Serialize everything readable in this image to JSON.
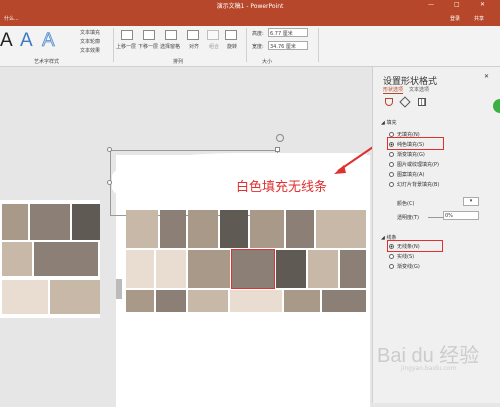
{
  "window": {
    "title": "演示文稿1 - PowerPoint",
    "login": "登录",
    "share": "共享",
    "min": "—",
    "max": "□",
    "close": "✕"
  },
  "ribbon_tabs": [
    "什么..."
  ],
  "ribbon": {
    "art_text_styles_label": "艺术字样式",
    "text_fill": "文本填充",
    "text_outline": "文本轮廓",
    "text_effects": "文本效果",
    "bring_forward": "上移一层",
    "send_backward": "下移一层",
    "selection_pane": "选择窗格",
    "align": "对齐",
    "group": "组合",
    "rotate": "旋转",
    "arrange_label": "排列",
    "height_label": "高度:",
    "height_value": "6.77 厘米",
    "width_label": "宽度:",
    "width_value": "34.76 厘米",
    "size_label": "大小",
    "art_A": "A"
  },
  "slide": {
    "caption": "白色填充无线条"
  },
  "pane": {
    "title": "设置形状格式",
    "tab_shape": "形状选项",
    "tab_text": "文本选项",
    "fill_header": "填充",
    "fill_options": [
      "无填充(N)",
      "纯色填充(S)",
      "渐变填充(G)",
      "图片或纹理填充(P)",
      "图案填充(A)",
      "幻灯片背景填充(B)"
    ],
    "fill_selected": 1,
    "color_label": "颜色(C)",
    "transparency_label": "透明度(T)",
    "transparency_value": "0%",
    "line_header": "线条",
    "line_options": [
      "无线条(N)",
      "实线(S)",
      "渐变线(G)"
    ],
    "line_selected": 0
  },
  "watermark": "Bai du 经验",
  "watermark_url": "jingyan.baidu.com",
  "colors": {
    "accent": "#b7472a",
    "highlight": "#e03030"
  }
}
